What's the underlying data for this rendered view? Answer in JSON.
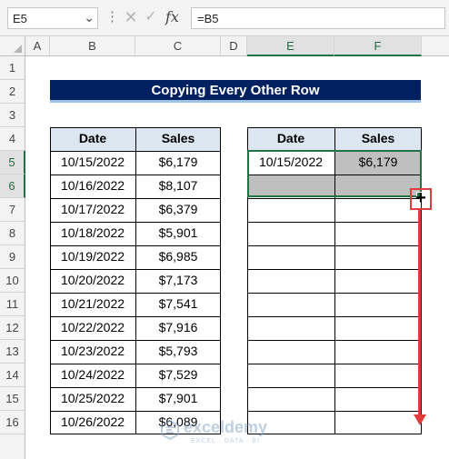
{
  "formula_bar": {
    "name_box": "E5",
    "formula": "=B5"
  },
  "columns": [
    "A",
    "B",
    "C",
    "D",
    "E",
    "F"
  ],
  "rows": [
    "1",
    "2",
    "3",
    "4",
    "5",
    "6",
    "7",
    "8",
    "9",
    "10",
    "11",
    "12",
    "13",
    "14",
    "15",
    "16"
  ],
  "title": "Copying Every Other Row",
  "table1": {
    "headers": [
      "Date",
      "Sales"
    ],
    "rows": [
      [
        "10/15/2022",
        "$6,179"
      ],
      [
        "10/16/2022",
        "$8,107"
      ],
      [
        "10/17/2022",
        "$6,379"
      ],
      [
        "10/18/2022",
        "$5,901"
      ],
      [
        "10/19/2022",
        "$6,985"
      ],
      [
        "10/20/2022",
        "$7,173"
      ],
      [
        "10/21/2022",
        "$7,541"
      ],
      [
        "10/22/2022",
        "$7,916"
      ],
      [
        "10/23/2022",
        "$5,793"
      ],
      [
        "10/24/2022",
        "$7,529"
      ],
      [
        "10/25/2022",
        "$7,901"
      ],
      [
        "10/26/2022",
        "$6,089"
      ]
    ]
  },
  "table2": {
    "headers": [
      "Date",
      "Sales"
    ],
    "rows": [
      [
        "10/15/2022",
        "$6,179"
      ]
    ]
  },
  "watermark": {
    "name": "exceldemy",
    "tagline": "EXCEL · DATA · BI"
  },
  "colors": {
    "title_fill": "#002060",
    "header_fill": "#dce6f1",
    "selection_border": "#217346",
    "annotation": "#e03c3c"
  }
}
